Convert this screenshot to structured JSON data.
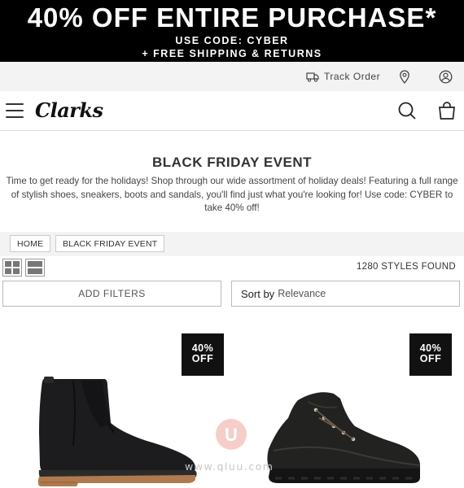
{
  "promo": {
    "headline": "40% OFF ENTIRE PURCHASE*",
    "code_line": "USE CODE: CYBER",
    "shipping_line": "+ FREE SHIPPING & RETURNS"
  },
  "utility_bar": {
    "track_order_label": "Track Order",
    "icons": [
      "truck-icon",
      "location-pin-icon",
      "account-icon"
    ]
  },
  "header": {
    "logo_text": "Clarks",
    "icons": [
      "menu-icon",
      "search-icon",
      "bag-icon"
    ]
  },
  "page": {
    "title": "BLACK FRIDAY EVENT",
    "intro": "Time to get ready for the holidays! Shop through our wide assortment of holiday deals! Featuring a full range of stylish shoes, sneakers, boots and sandals, you'll find just what you're looking for! Use code: CYBER to take 40% off!"
  },
  "breadcrumb": {
    "items": [
      "HOME",
      "BLACK FRIDAY EVENT"
    ]
  },
  "listing": {
    "count_text": "1280 STYLES FOUND",
    "view_icons": [
      "grid-view-icon",
      "list-view-icon"
    ],
    "add_filters_label": "ADD FILTERS",
    "sort_label": "Sort by",
    "sort_value": "Relevance"
  },
  "products": [
    {
      "badge_line1": "40%",
      "badge_line2": "OFF",
      "image": "black-suede-chelsea-boot"
    },
    {
      "badge_line1": "40%",
      "badge_line2": "OFF",
      "image": "black-leather-hiking-boot"
    }
  ],
  "watermark": {
    "logo_letter": "U",
    "text": "www.qluu.com"
  },
  "colors": {
    "promo_bg": "#000000",
    "utility_bg": "#f3f3f3",
    "badge_bg": "#111111",
    "text": "#222222"
  }
}
